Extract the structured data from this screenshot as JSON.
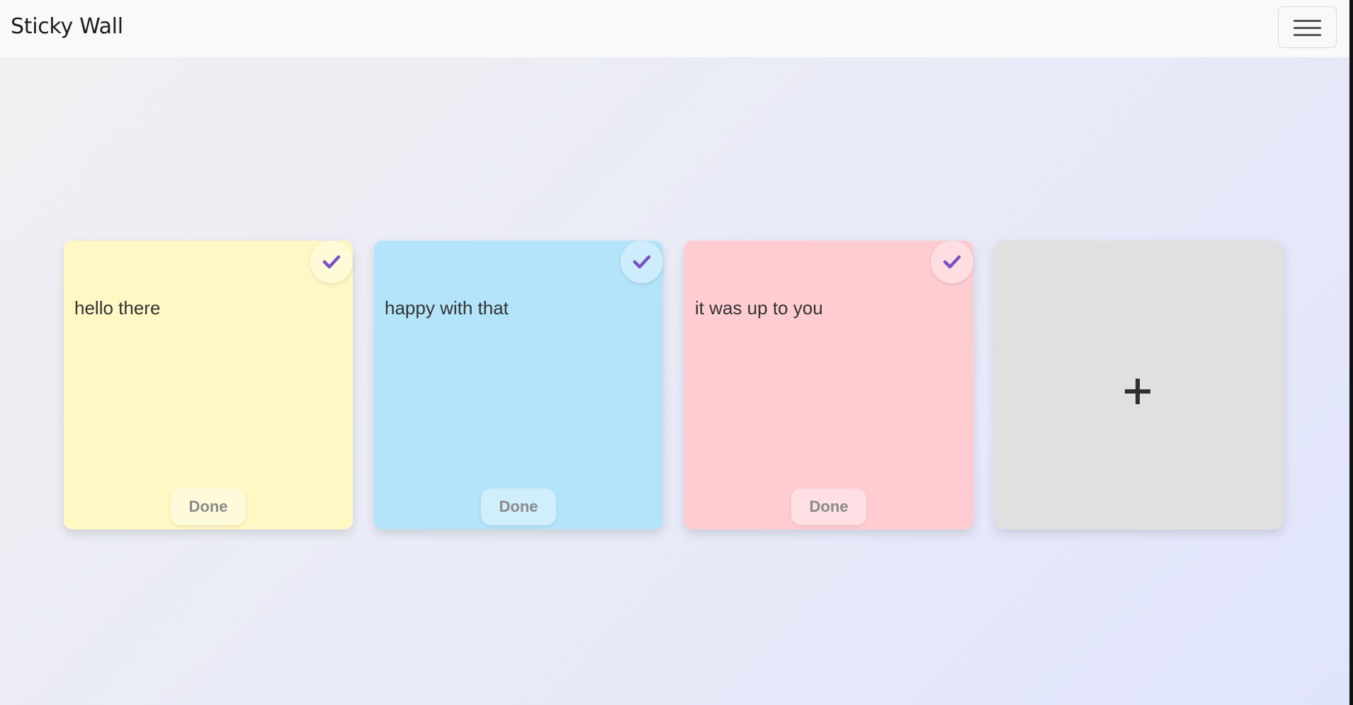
{
  "app": {
    "title": "Sticky Wall"
  },
  "navbar": {
    "toggle_icon": "hamburger-menu-icon"
  },
  "notes": [
    {
      "text": "hello there",
      "color": "#fff8c4",
      "done_label": "Done",
      "check_icon": "checkmark-icon"
    },
    {
      "text": "happy with that",
      "color": "#b3e4fa",
      "done_label": "Done",
      "check_icon": "checkmark-icon"
    },
    {
      "text": "it was up to you",
      "color": "#ffccd2",
      "done_label": "Done",
      "check_icon": "checkmark-icon"
    }
  ],
  "add_note": {
    "icon": "plus-icon",
    "color": "#e0e0e0"
  },
  "colors": {
    "check": "#7a52c7"
  }
}
